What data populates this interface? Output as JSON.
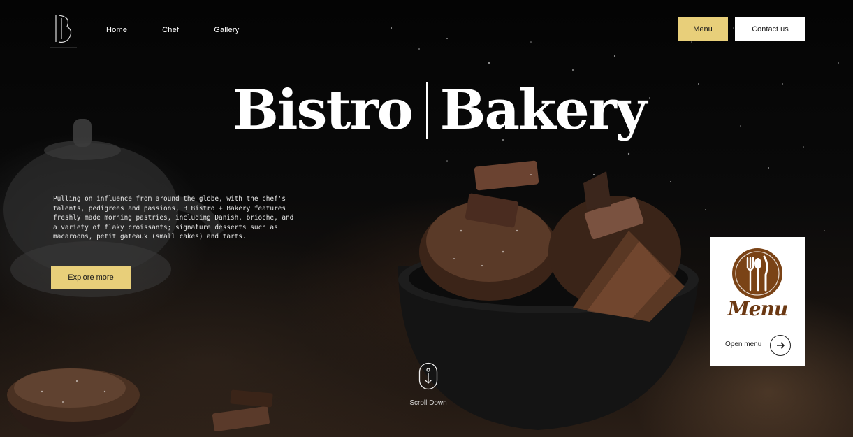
{
  "nav": {
    "logo_alt": "B",
    "items": [
      {
        "label": "Home"
      },
      {
        "label": "Chef"
      },
      {
        "label": "Gallery"
      }
    ]
  },
  "header_actions": {
    "menu_label": "Menu",
    "contact_label": "Contact us"
  },
  "hero": {
    "title_left": "Bistro",
    "title_right": "Bakery",
    "intro": "Pulling on influence from around the globe, with the chef's talents, pedigrees and passions, B Bistro + Bakery features freshly made morning pastries, including Danish, brioche, and a variety of flaky croissants; signature desserts such as macaroons, petit gateaux (small cakes) and tarts.",
    "explore_label": "Explore more",
    "scroll_label": "Scroll Down"
  },
  "menu_card": {
    "script_title": "Menu",
    "open_label": "Open menu"
  },
  "colors": {
    "accent": "#e8cf7a",
    "brand_brown": "#6b3812"
  }
}
